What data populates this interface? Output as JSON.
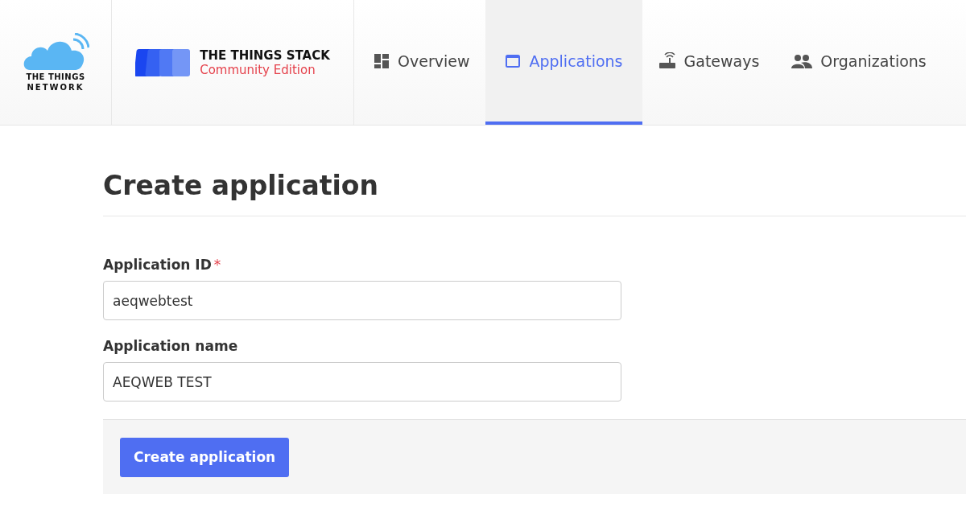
{
  "header": {
    "network_logo": {
      "line_1": "THE THINGS",
      "line_2": "NETWORK"
    },
    "stack_logo": {
      "title": "THE THINGS STACK",
      "edition": "Community Edition"
    },
    "tabs": [
      {
        "label": "Overview",
        "kind": "overview",
        "selected": false
      },
      {
        "label": "Applications",
        "kind": "application",
        "selected": true
      },
      {
        "label": "Gateways",
        "kind": "gateway",
        "selected": false
      },
      {
        "label": "Organizations",
        "kind": "people",
        "selected": false
      }
    ]
  },
  "page": {
    "title": "Create application",
    "fields": [
      {
        "label": "Application ID",
        "required": true,
        "value": "aeqwebtest"
      },
      {
        "label": "Application name",
        "required": false,
        "value": "AEQWEB TEST"
      }
    ],
    "required_mark": "*",
    "submit_button": "Create application"
  }
}
